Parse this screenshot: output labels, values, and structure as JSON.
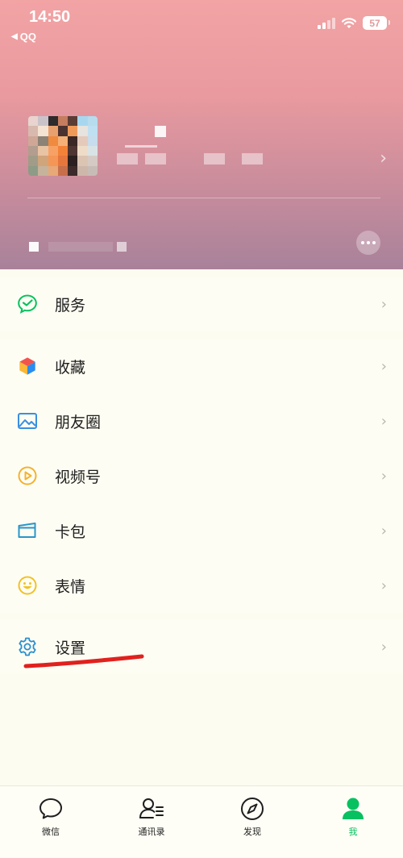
{
  "status_bar": {
    "time": "14:50",
    "back_app": "QQ",
    "battery": "57"
  },
  "menu": {
    "services": {
      "label": "服务"
    },
    "items": [
      {
        "label": "收藏"
      },
      {
        "label": "朋友圈"
      },
      {
        "label": "视频号"
      },
      {
        "label": "卡包"
      },
      {
        "label": "表情"
      }
    ],
    "settings": {
      "label": "设置"
    }
  },
  "tabs": [
    {
      "label": "微信",
      "icon": "chat-bubble-icon",
      "active": false
    },
    {
      "label": "通讯录",
      "icon": "contacts-icon",
      "active": false
    },
    {
      "label": "发现",
      "icon": "compass-icon",
      "active": false
    },
    {
      "label": "我",
      "icon": "person-icon",
      "active": true
    }
  ],
  "colors": {
    "accent_green": "#07c160",
    "annotation_red": "#e0211e"
  }
}
